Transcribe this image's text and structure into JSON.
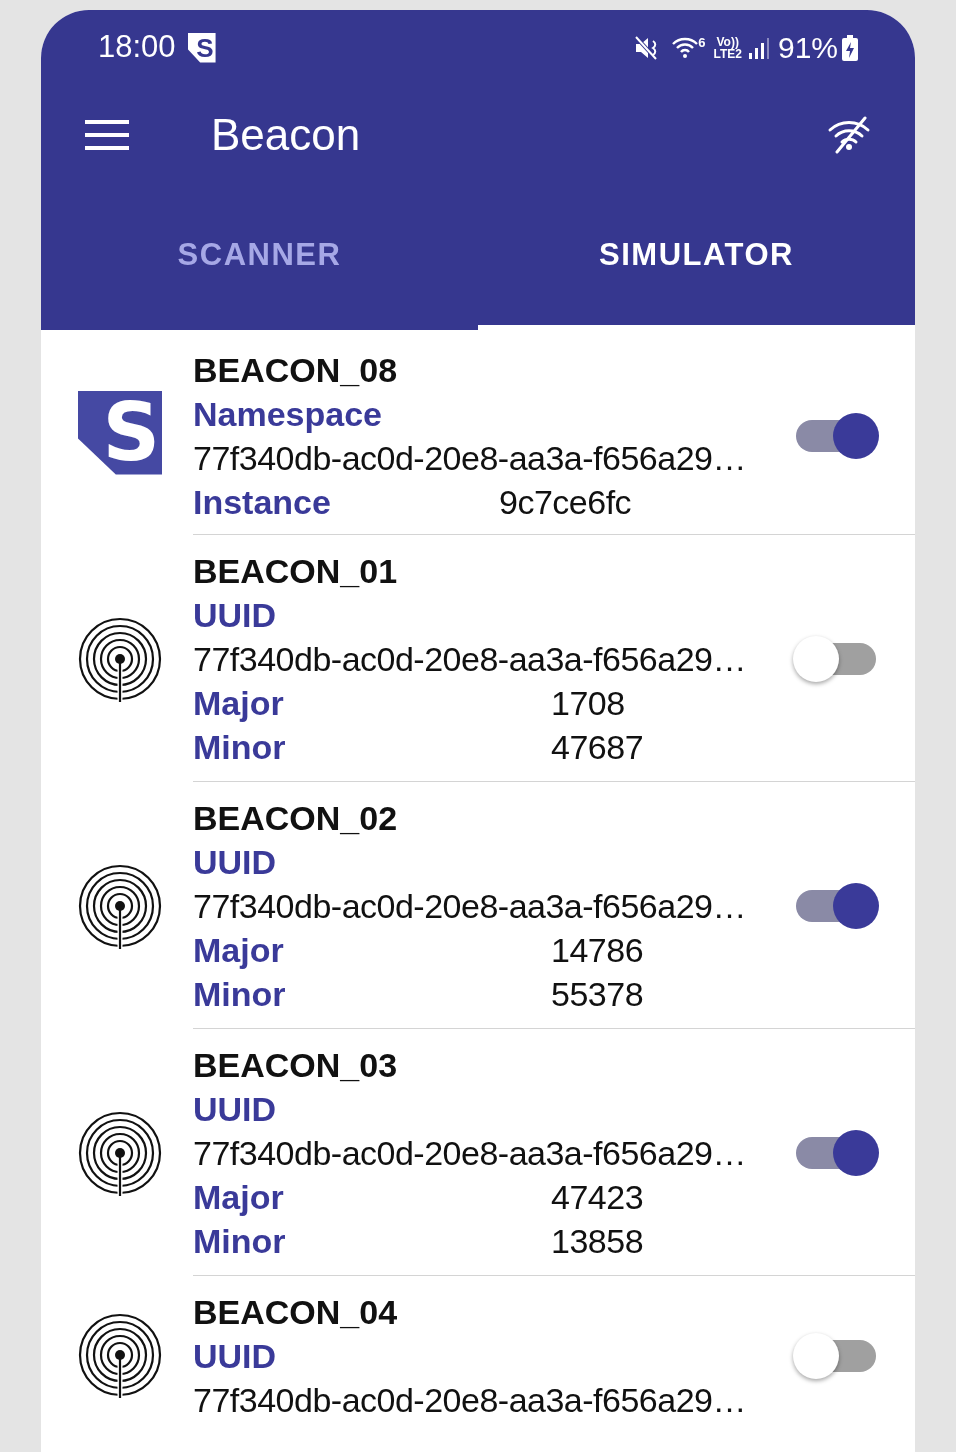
{
  "status_bar": {
    "time": "18:00",
    "app_badge_letter": "S",
    "wifi_band": "6",
    "volte": "Vo))",
    "lte": "LTE2",
    "battery": "91%"
  },
  "toolbar": {
    "title": "Beacon"
  },
  "tabs": [
    {
      "label": "SCANNER",
      "selected": false
    },
    {
      "label": "SIMULATOR",
      "selected": true
    }
  ],
  "beacons": [
    {
      "kind": "eddystone",
      "name": "BEACON_08",
      "logo_letter": "S",
      "on": true,
      "fields": [
        {
          "label": "Namespace"
        },
        {
          "value": "77f340db-ac0d-20e8-aa3a-f656a29…"
        },
        {
          "label": "Instance",
          "value": "9c7ce6fc"
        }
      ]
    },
    {
      "kind": "ibeacon",
      "name": "BEACON_01",
      "on": false,
      "fields": [
        {
          "label": "UUID"
        },
        {
          "value": "77f340db-ac0d-20e8-aa3a-f656a29…"
        },
        {
          "label": "Major",
          "value": "1708"
        },
        {
          "label": "Minor",
          "value": "47687"
        }
      ]
    },
    {
      "kind": "ibeacon",
      "name": "BEACON_02",
      "on": true,
      "fields": [
        {
          "label": "UUID"
        },
        {
          "value": "77f340db-ac0d-20e8-aa3a-f656a29…"
        },
        {
          "label": "Major",
          "value": "14786"
        },
        {
          "label": "Minor",
          "value": "55378"
        }
      ]
    },
    {
      "kind": "ibeacon",
      "name": "BEACON_03",
      "on": true,
      "fields": [
        {
          "label": "UUID"
        },
        {
          "value": "77f340db-ac0d-20e8-aa3a-f656a29…"
        },
        {
          "label": "Major",
          "value": "47423"
        },
        {
          "label": "Minor",
          "value": "13858"
        }
      ]
    },
    {
      "kind": "ibeacon",
      "name": "BEACON_04",
      "on": false,
      "fields": [
        {
          "label": "UUID"
        },
        {
          "value": "77f340db-ac0d-20e8-aa3a-f656a29…"
        }
      ]
    }
  ]
}
